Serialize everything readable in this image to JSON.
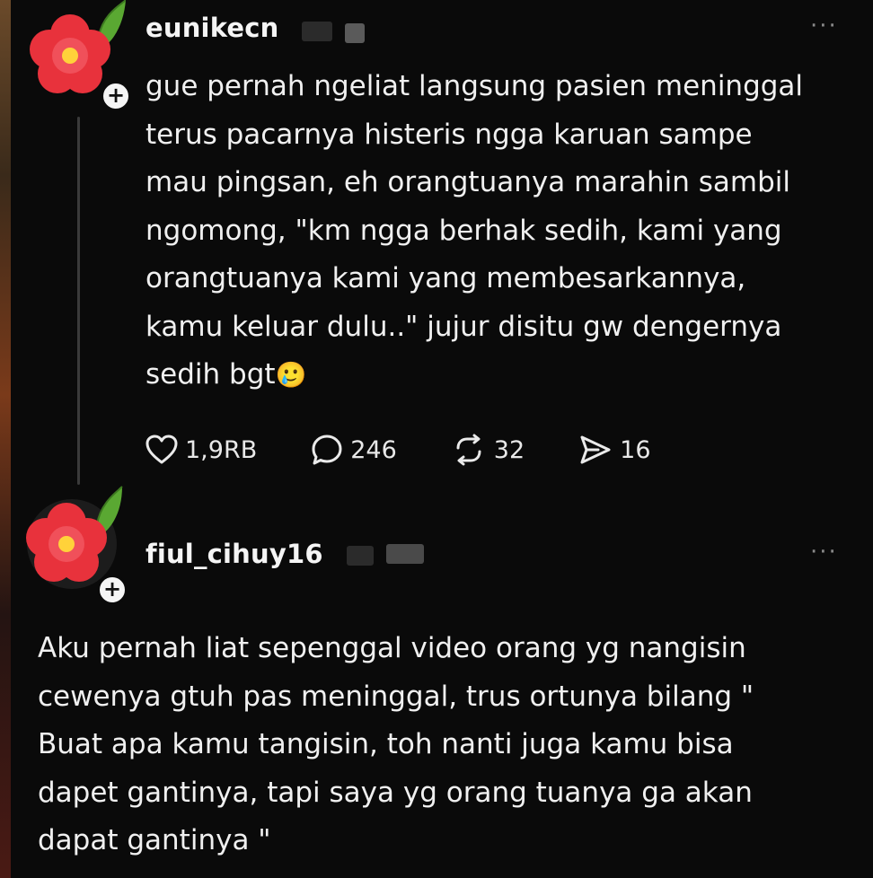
{
  "posts": [
    {
      "username": "eunikecn",
      "text": "gue pernah ngeliat langsung pasien meninggal\nterus pacarnya histeris ngga karuan sampe\nmau pingsan, eh orangtuanya marahin sambil\nngomong, \"km ngga berhak sedih, kami yang\norangtuanya kami yang membesarkannya,\nkamu keluar dulu..\" jujur disitu gw dengernya\nsedih bgt",
      "emoji": "🥲",
      "actions": {
        "likes": "1,9RB",
        "comments": "246",
        "reposts": "32",
        "shares": "16"
      },
      "more_label": "···"
    },
    {
      "username": "fiul_cihuy16",
      "text": "Aku pernah liat sepenggal video orang yg nangisin\ncewenya gtuh pas meninggal, trus ortunya bilang \"\nBuat apa kamu tangisin, toh nanti juga kamu  bisa\ndapet gantinya, tapi saya yg orang tuanya ga akan\ndapat gantinya \"",
      "more_label": "···"
    }
  ],
  "icons": {
    "avatar": "red-flower-avatar",
    "follow": "plus-icon",
    "like": "heart-icon",
    "comment": "speech-bubble-icon",
    "repost": "repost-icon",
    "share": "send-icon"
  },
  "colors": {
    "background": "#0a0a0a",
    "text": "#f0f0f0",
    "muted": "#8a8a8a",
    "flower": "#e8323c",
    "leaf": "#5aa832"
  }
}
